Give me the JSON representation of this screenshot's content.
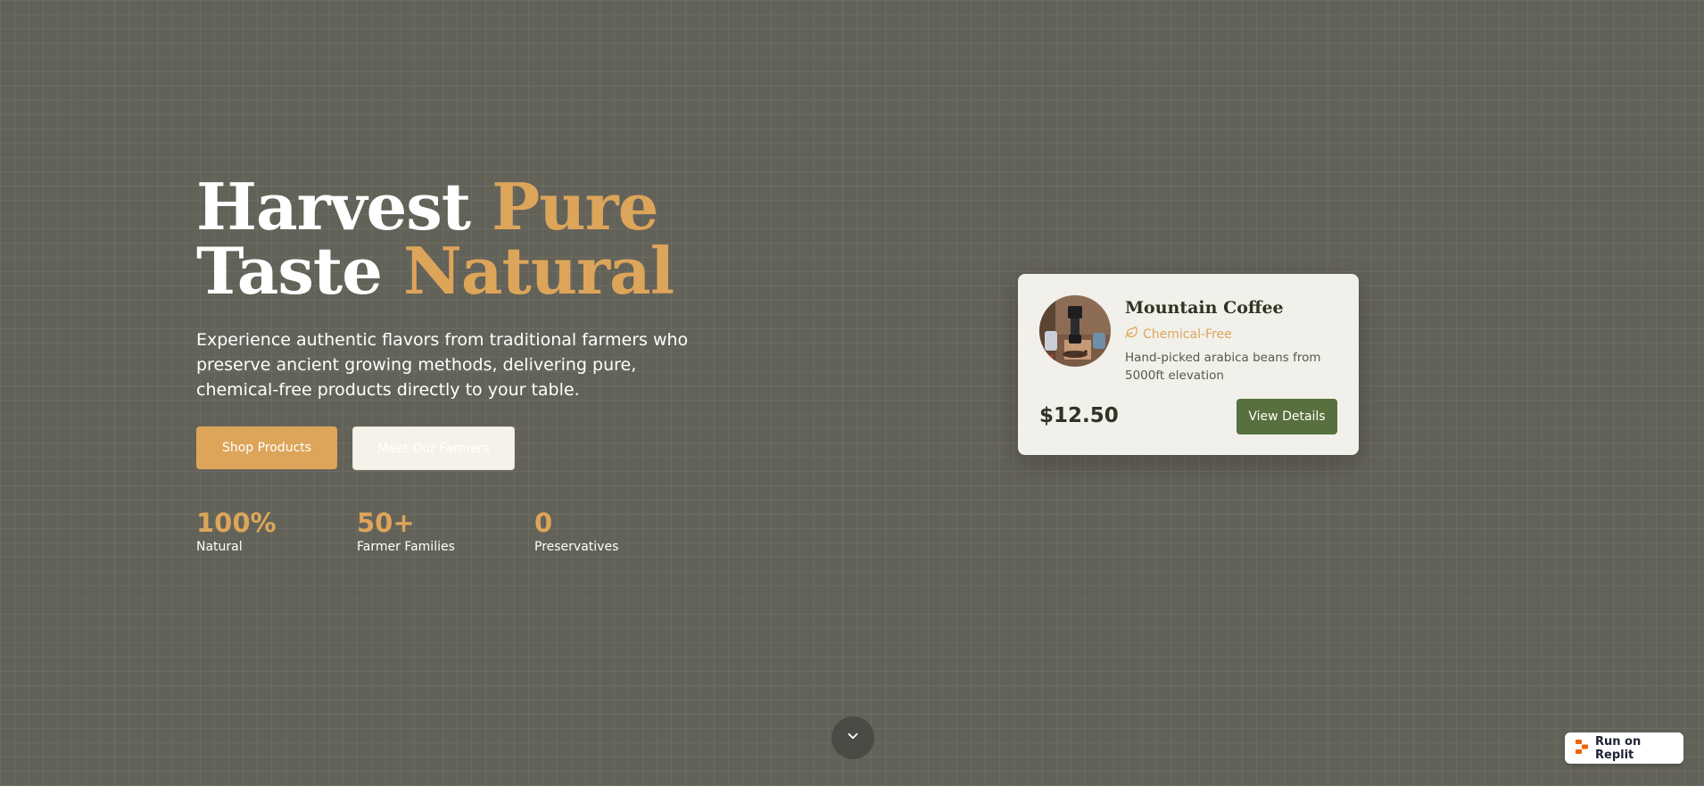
{
  "hero": {
    "headline_line1_main": "Harvest",
    "headline_line1_accent": "Pure",
    "headline_line2_main": "Taste",
    "headline_line2_accent": "Natural",
    "subtitle": "Experience authentic flavors from traditional farmers who preserve ancient growing methods, delivering pure, chemical-free products directly to your table.",
    "primary_button": "Shop Products",
    "secondary_button": "Meet Our Farmers"
  },
  "stats": [
    {
      "value": "100%",
      "label": "Natural"
    },
    {
      "value": "50+",
      "label": "Farmer Families"
    },
    {
      "value": "0",
      "label": "Preservatives"
    }
  ],
  "product_card": {
    "title": "Mountain Coffee",
    "badge_icon": "leaf-icon",
    "badge": "Chemical-Free",
    "description": "Hand-picked arabica beans from 5000ft elevation",
    "price": "$12.50",
    "button": "View Details"
  },
  "scroll_indicator": {
    "icon": "chevron-down-icon"
  },
  "replit_badge": {
    "icon": "replit-logo-icon",
    "label": "Run on Replit"
  },
  "colors": {
    "background": "#636259",
    "accent": "#dda55a",
    "primary_green": "#57703d",
    "card_background": "#f1f0ea",
    "text_dark": "#2f3423"
  }
}
